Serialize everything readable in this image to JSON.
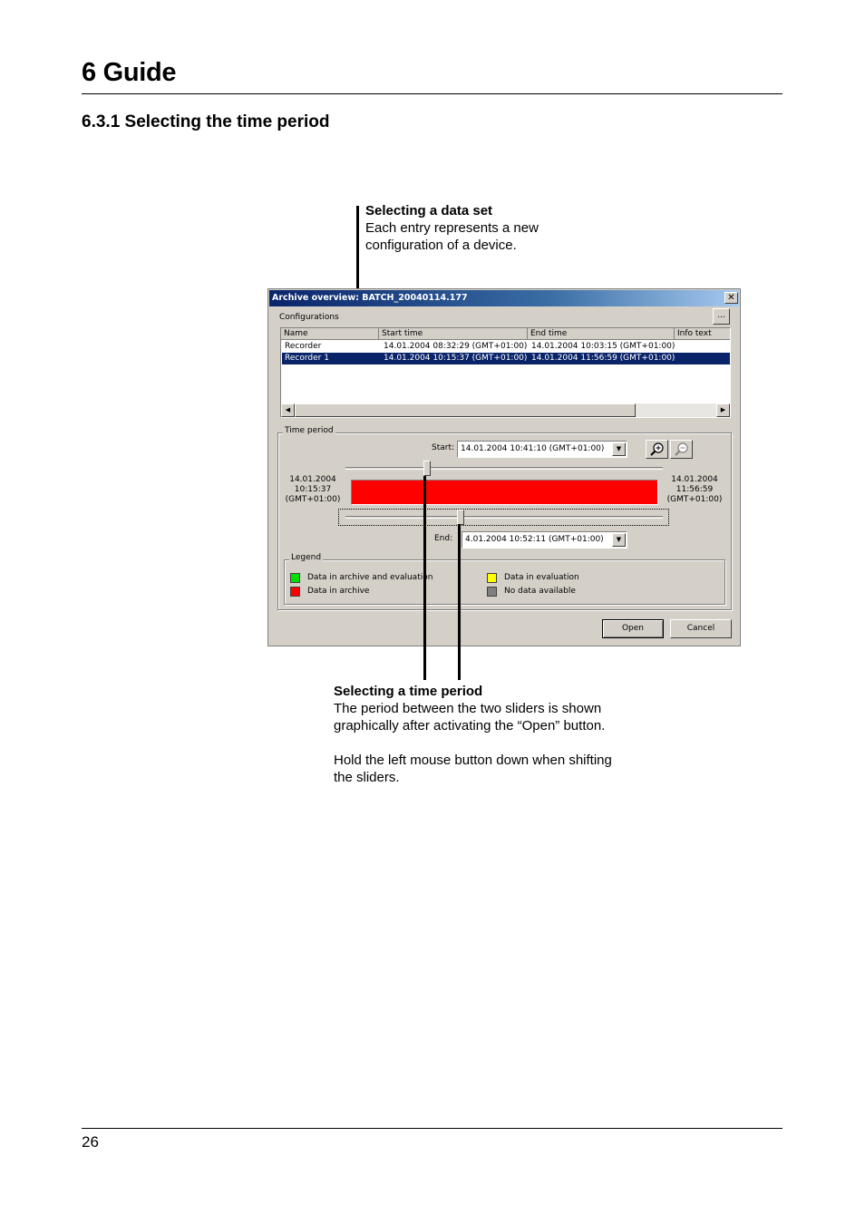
{
  "page": {
    "chapter": "6 Guide",
    "section": "6.3.1 Selecting the time period",
    "page_number": "26"
  },
  "callouts": {
    "data_set": {
      "title": "Selecting a data set",
      "line1": "Each entry represents a new",
      "line2": "configuration of a device."
    },
    "time_period": {
      "title": "Selecting a time period",
      "line1": "The period between the two sliders is shown",
      "line2": "graphically after activating the “Open” button.",
      "line3": "Hold the left mouse button down when shifting",
      "line4": "the sliders."
    }
  },
  "dialog": {
    "title": "Archive overview: BATCH_20040114.177",
    "close_glyph": "✕",
    "configurations_label": "Configurations",
    "browse_label": "...",
    "columns": [
      "Name",
      "Start time",
      "End time",
      "Info text"
    ],
    "rows": [
      {
        "name": "Recorder",
        "start": "14.01.2004 08:32:29 (GMT+01:00)",
        "end": "14.01.2004 10:03:15 (GMT+01:00)",
        "info": "",
        "selected": false
      },
      {
        "name": "Recorder 1",
        "start": "14.01.2004 10:15:37 (GMT+01:00)",
        "end": "14.01.2004 11:56:59 (GMT+01:00)",
        "info": "",
        "selected": true
      }
    ],
    "scroll_left": "◀",
    "scroll_right": "▶",
    "time_period_label": "Time period",
    "start_label": "Start:",
    "start_value": "14.01.2004 10:41:10    (GMT+01:00)",
    "end_label": "End:",
    "end_value": "4.01.2004 10:52:11    (GMT+01:00)",
    "combo_arrow": "▼",
    "range_start": {
      "date": "14.01.2004",
      "time": "10:15:37",
      "tz": "(GMT+01:00)"
    },
    "range_end": {
      "date": "14.01.2004",
      "time": "11:56:59",
      "tz": "(GMT+01:00)"
    },
    "legend_label": "Legend",
    "legend": [
      {
        "label": "Data in archive and evaluation",
        "color": "#00e000"
      },
      {
        "label": "Data in archive",
        "color": "#ff0000"
      },
      {
        "label": "Data in evaluation",
        "color": "#ffff00"
      },
      {
        "label": "No data available",
        "color": "#808080"
      }
    ],
    "bar_color": "#ff0000",
    "open_label": "Open",
    "cancel_label": "Cancel"
  }
}
